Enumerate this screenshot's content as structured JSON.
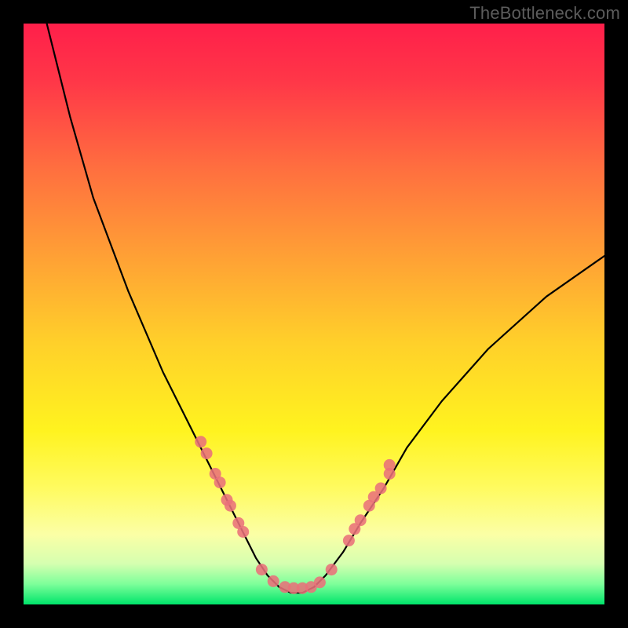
{
  "watermark": "TheBottleneck.com",
  "chart_data": {
    "type": "line",
    "title": "",
    "xlabel": "",
    "ylabel": "",
    "xlim": [
      0,
      100
    ],
    "ylim": [
      0,
      100
    ],
    "grid": false,
    "series": [
      {
        "name": "bottleneck-curve",
        "color": "#000000",
        "x": [
          4,
          6,
          8,
          10,
          12,
          15,
          18,
          21,
          24,
          27,
          30,
          33,
          36,
          38,
          40,
          42,
          44,
          46,
          48,
          50,
          52,
          55,
          58,
          62,
          66,
          72,
          80,
          90,
          100
        ],
        "y": [
          100,
          92,
          84,
          77,
          70,
          62,
          54,
          47,
          40,
          34,
          28,
          22,
          16,
          12,
          8,
          5,
          3,
          2,
          2,
          3,
          5,
          9,
          14,
          20,
          27,
          35,
          44,
          53,
          60
        ]
      }
    ],
    "scatter_overlay": {
      "name": "sample-points",
      "color": "#e9717a",
      "points": [
        {
          "x": 30.5,
          "y": 28
        },
        {
          "x": 31.5,
          "y": 26
        },
        {
          "x": 33,
          "y": 22.5
        },
        {
          "x": 33.8,
          "y": 21
        },
        {
          "x": 35,
          "y": 18
        },
        {
          "x": 35.6,
          "y": 17
        },
        {
          "x": 37,
          "y": 14
        },
        {
          "x": 37.8,
          "y": 12.5
        },
        {
          "x": 41,
          "y": 6
        },
        {
          "x": 43,
          "y": 4
        },
        {
          "x": 45,
          "y": 3
        },
        {
          "x": 46.5,
          "y": 2.8
        },
        {
          "x": 48,
          "y": 2.8
        },
        {
          "x": 49.5,
          "y": 3
        },
        {
          "x": 51,
          "y": 3.8
        },
        {
          "x": 53,
          "y": 6
        },
        {
          "x": 56,
          "y": 11
        },
        {
          "x": 57,
          "y": 13
        },
        {
          "x": 58,
          "y": 14.5
        },
        {
          "x": 59.5,
          "y": 17
        },
        {
          "x": 60.3,
          "y": 18.5
        },
        {
          "x": 61.5,
          "y": 20
        },
        {
          "x": 63,
          "y": 22.5
        },
        {
          "x": 63,
          "y": 24
        }
      ]
    },
    "background": {
      "type": "vertical-gradient",
      "stops": [
        {
          "offset": 0.0,
          "color": "#ff1f4a"
        },
        {
          "offset": 0.1,
          "color": "#ff3748"
        },
        {
          "offset": 0.25,
          "color": "#ff6f3f"
        },
        {
          "offset": 0.4,
          "color": "#ffa035"
        },
        {
          "offset": 0.55,
          "color": "#ffd02a"
        },
        {
          "offset": 0.7,
          "color": "#fff31f"
        },
        {
          "offset": 0.8,
          "color": "#fffb60"
        },
        {
          "offset": 0.88,
          "color": "#fbffa6"
        },
        {
          "offset": 0.93,
          "color": "#d5ffb0"
        },
        {
          "offset": 0.965,
          "color": "#7dff9a"
        },
        {
          "offset": 1.0,
          "color": "#00e46a"
        }
      ]
    }
  }
}
